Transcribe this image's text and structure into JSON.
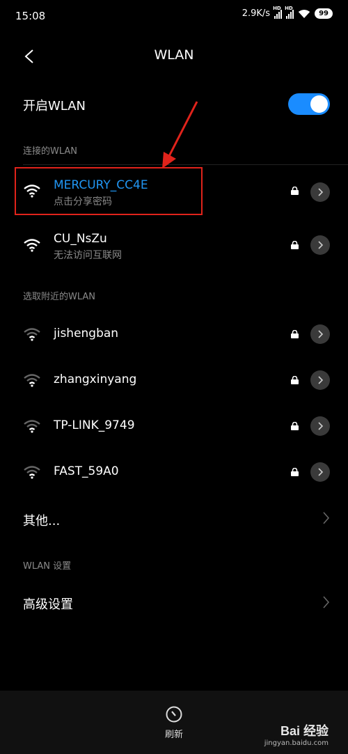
{
  "status_bar": {
    "time": "15:08",
    "speed": "2.9K/s",
    "hd1": "HD",
    "hd2": "HD",
    "battery": "99"
  },
  "header": {
    "title": "WLAN",
    "back_icon": "back-chevron-icon"
  },
  "wlan_toggle": {
    "label": "开启WLAN",
    "on": true,
    "color": "#1a8cff"
  },
  "connected_section": {
    "title": "连接的WLAN"
  },
  "connected": [
    {
      "name": "MERCURY_CC4E",
      "subtitle": "点击分享密码",
      "active": true
    },
    {
      "name": "CU_NsZu",
      "subtitle": "无法访问互联网",
      "active": false
    }
  ],
  "nearby_section": {
    "title": "选取附近的WLAN"
  },
  "nearby": [
    {
      "name": "jishengban"
    },
    {
      "name": "zhangxinyang"
    },
    {
      "name": "TP-LINK_9749"
    },
    {
      "name": "FAST_59A0"
    }
  ],
  "other": {
    "label": "其他..."
  },
  "settings_section": {
    "title": "WLAN 设置"
  },
  "advanced": {
    "label": "高级设置"
  },
  "bottom_bar": {
    "refresh_label": "刷新"
  },
  "watermark": {
    "brand": "Bai 经验",
    "url": "jingyan.baidu.com"
  },
  "colors": {
    "accent": "#2196f3",
    "annotation": "#e0231b"
  }
}
